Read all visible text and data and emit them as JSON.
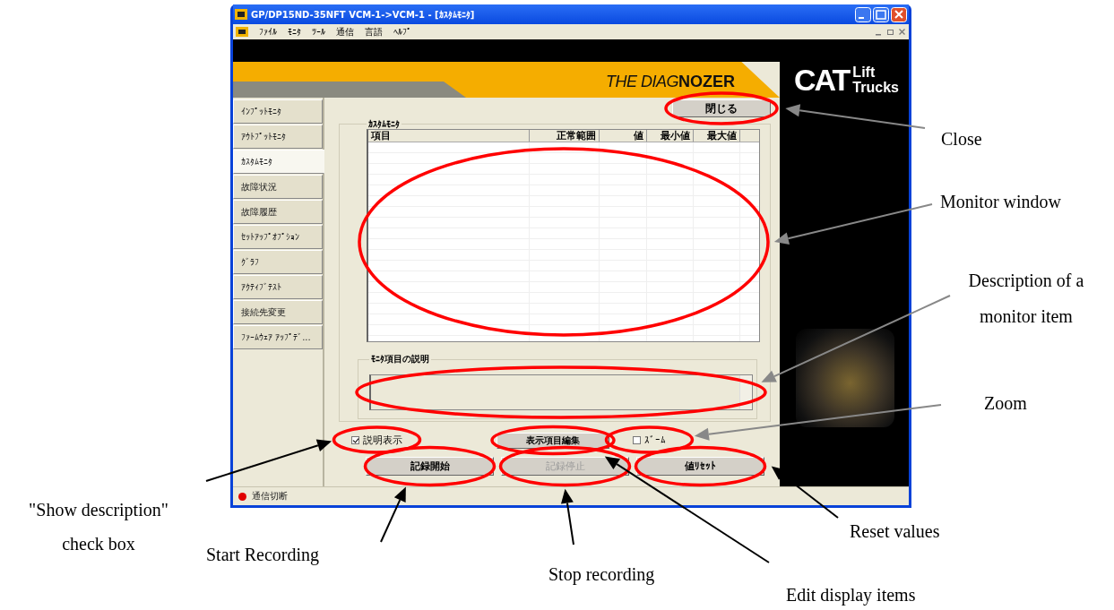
{
  "window": {
    "title": "GP/DP15ND-35NFT VCM-1->VCM-1 - [ｶｽﾀﾑﾓﾆﾀ]"
  },
  "menu": [
    "ﾌｧｲﾙ",
    "ﾓﾆﾀ",
    "ﾂｰﾙ",
    "通信",
    "言語",
    "ﾍﾙﾌﾟ"
  ],
  "banner": {
    "product_prefix": "THE DIAG",
    "product_name": "NOZER",
    "logo": "CAT",
    "logo_sub_1": "Lift",
    "logo_sub_2": "Trucks"
  },
  "sidebar": {
    "items": [
      {
        "label": "ｲﾝﾌﾟｯﾄﾓﾆﾀ",
        "selected": false
      },
      {
        "label": "ｱｳﾄﾌﾟｯﾄﾓﾆﾀ",
        "selected": false
      },
      {
        "label": "ｶｽﾀﾑﾓﾆﾀ",
        "selected": true
      },
      {
        "label": "故障状況",
        "selected": false
      },
      {
        "label": "故障履歴",
        "selected": false
      },
      {
        "label": "ｾｯﾄｱｯﾌﾟｵﾌﾟｼｮﾝ",
        "selected": false
      },
      {
        "label": "ｸﾞﾗﾌ",
        "selected": false
      },
      {
        "label": "ｱｸﾃｨﾌﾞﾃｽﾄ",
        "selected": false
      },
      {
        "label": "接続先変更",
        "selected": false
      },
      {
        "label": "ﾌｧｰﾑｳｪｱ ｱｯﾌﾟﾃﾞ...",
        "selected": false
      }
    ]
  },
  "close_button": "閉じる",
  "monitor_group": {
    "title": "ｶｽﾀﾑﾓﾆﾀ",
    "table": {
      "columns": [
        "項目",
        "正常範囲",
        "値",
        "最小値",
        "最大値"
      ]
    },
    "description_group": {
      "title": "ﾓﾆﾀ項目の説明"
    }
  },
  "controls": [
    {
      "kind": "checkbox",
      "label": "説明表示",
      "checked": true
    },
    {
      "kind": "button",
      "label": "表示項目編集",
      "disabled": false
    },
    {
      "kind": "checkbox",
      "label": "ｽﾞｰﾑ",
      "checked": false
    }
  ],
  "buttons": [
    {
      "label": "記録開始",
      "disabled": false
    },
    {
      "label": "記録停止",
      "disabled": true
    },
    {
      "label": "値ﾘｾｯﾄ",
      "disabled": false
    }
  ],
  "status_bar": {
    "text": "通信切断",
    "connected": false
  },
  "annotations": [
    {
      "label": "Close"
    },
    {
      "label": "Monitor window"
    },
    {
      "label": "Description of a monitor item"
    },
    {
      "label": "Zoom"
    },
    {
      "label": "\"Show description\" check box"
    },
    {
      "label": "Start Recording"
    },
    {
      "label": "Stop recording"
    },
    {
      "label": "Reset values"
    },
    {
      "label": "Edit display items"
    }
  ]
}
